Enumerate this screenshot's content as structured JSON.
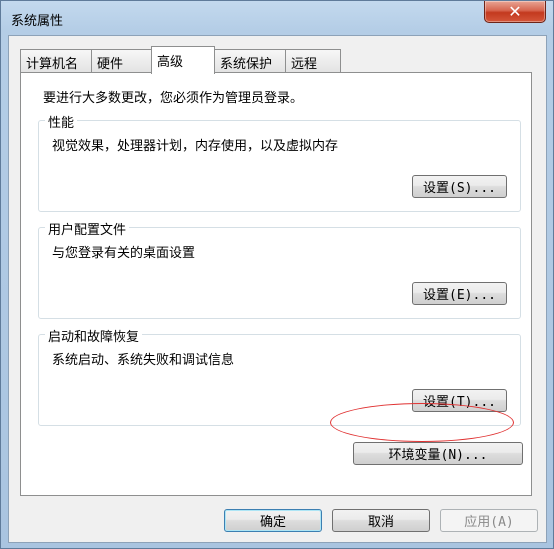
{
  "window": {
    "title": "系统属性",
    "close_glyph": "✕"
  },
  "tabs": [
    {
      "label": "计算机名"
    },
    {
      "label": "硬件"
    },
    {
      "label": "高级"
    },
    {
      "label": "系统保护"
    },
    {
      "label": "远程"
    }
  ],
  "advanced": {
    "intro": "要进行大多数更改，您必须作为管理员登录。",
    "performance": {
      "title": "性能",
      "description": "视觉效果，处理器计划，内存使用，以及虚拟内存",
      "button": "设置(S)..."
    },
    "user_profiles": {
      "title": "用户配置文件",
      "description": "与您登录有关的桌面设置",
      "button": "设置(E)..."
    },
    "startup_recovery": {
      "title": "启动和故障恢复",
      "description": "系统启动、系统失败和调试信息",
      "button": "设置(T)..."
    },
    "env_button": "环境变量(N)..."
  },
  "footer": {
    "ok": "确定",
    "cancel": "取消",
    "apply": "应用(A)"
  },
  "colors": {
    "highlight": "#e03131",
    "close_button": "#c3391e"
  }
}
